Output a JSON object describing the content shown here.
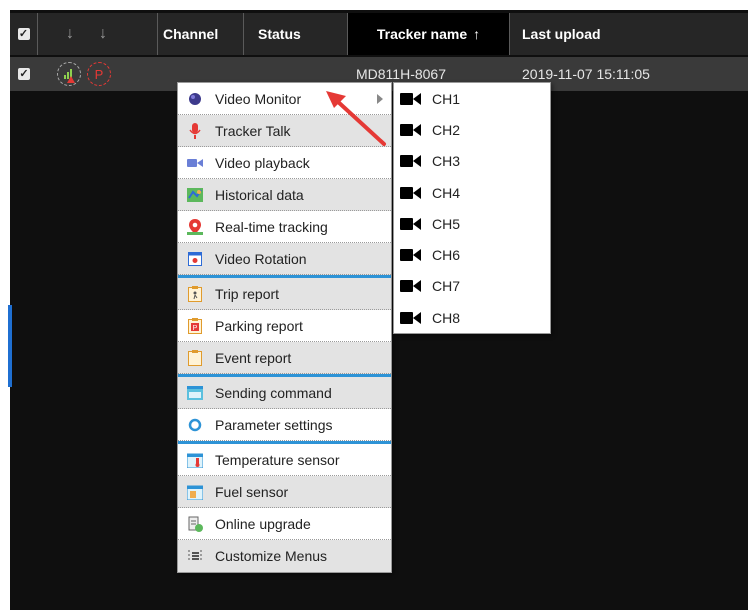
{
  "table": {
    "headers": {
      "channel": "Channel",
      "status": "Status",
      "tracker_name": "Tracker name",
      "tracker_sort_icon": "↑",
      "last_upload": "Last upload",
      "sort_down_1": "↓",
      "sort_down_2": "↓"
    },
    "row": {
      "tracker_name": "MD811H-8067",
      "last_upload": "2019-11-07 15:11:05"
    }
  },
  "context_menu": {
    "items": [
      {
        "label": "Video Monitor",
        "icon": "globe-icon"
      },
      {
        "label": "Tracker Talk",
        "icon": "microphone-icon"
      },
      {
        "label": "Video playback",
        "icon": "video-camera-icon"
      },
      {
        "label": "Historical data",
        "icon": "map-icon"
      },
      {
        "label": "Real-time tracking",
        "icon": "location-pin-icon"
      },
      {
        "label": "Video Rotation",
        "icon": "video-rotation-icon"
      },
      {
        "label": "Trip report",
        "icon": "trip-report-icon"
      },
      {
        "label": "Parking report",
        "icon": "parking-report-icon"
      },
      {
        "label": "Event report",
        "icon": "event-report-icon"
      },
      {
        "label": "Sending command",
        "icon": "command-window-icon"
      },
      {
        "label": "Parameter settings",
        "icon": "circle-settings-icon"
      },
      {
        "label": "Temperature sensor",
        "icon": "thermometer-icon"
      },
      {
        "label": "Fuel sensor",
        "icon": "fuel-icon"
      },
      {
        "label": "Online upgrade",
        "icon": "upgrade-icon"
      },
      {
        "label": "Customize Menus",
        "icon": "menu-lines-icon"
      }
    ]
  },
  "submenu": {
    "channels": [
      "CH1",
      "CH2",
      "CH3",
      "CH4",
      "CH5",
      "CH6",
      "CH7",
      "CH8"
    ]
  },
  "colors": {
    "accent_separator": "#2d93d6",
    "header_bg": "#262626",
    "row_bg": "#3a3a3a",
    "annotation_arrow": "#e53935"
  }
}
